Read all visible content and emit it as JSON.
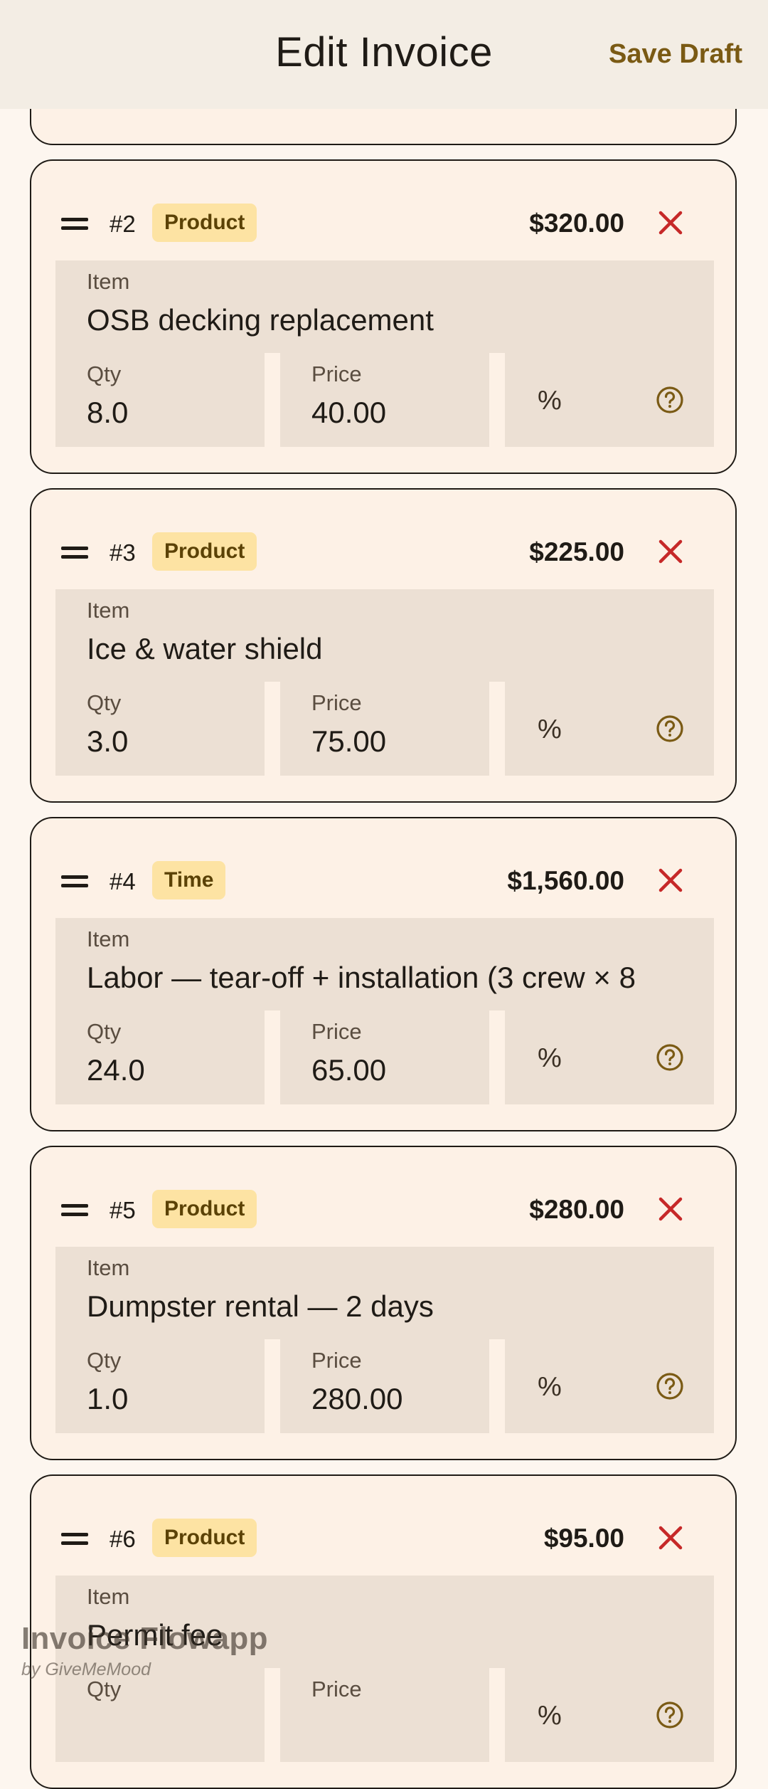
{
  "header": {
    "title": "Edit Invoice",
    "save_label": "Save Draft"
  },
  "field_labels": {
    "item": "Item",
    "qty": "Qty",
    "price": "Price",
    "percent": "%"
  },
  "colors": {
    "accent": "#7a5a14",
    "delete": "#c62828",
    "badge_bg": "#fde3a3",
    "card_bg": "#fdf1e6",
    "field_bg": "#ece0d4"
  },
  "items": [
    {
      "number": "#2",
      "type": "Product",
      "amount": "$320.00",
      "item": "OSB decking replacement",
      "qty": "8.0",
      "price": "40.00"
    },
    {
      "number": "#3",
      "type": "Product",
      "amount": "$225.00",
      "item": "Ice & water shield",
      "qty": "3.0",
      "price": "75.00"
    },
    {
      "number": "#4",
      "type": "Time",
      "amount": "$1,560.00",
      "item": "Labor — tear-off + installation (3 crew × 8",
      "qty": "24.0",
      "price": "65.00"
    },
    {
      "number": "#5",
      "type": "Product",
      "amount": "$280.00",
      "item": "Dumpster rental — 2 days",
      "qty": "1.0",
      "price": "280.00"
    },
    {
      "number": "#6",
      "type": "Product",
      "amount": "$95.00",
      "item": "Permit fee",
      "qty": "",
      "price": ""
    }
  ],
  "watermark": {
    "line1": "Invoice Flowapp",
    "line2": "by GiveMeMood"
  },
  "icons": {
    "drag": "drag-handle-icon",
    "delete": "close-icon",
    "help": "help-circle-icon"
  }
}
